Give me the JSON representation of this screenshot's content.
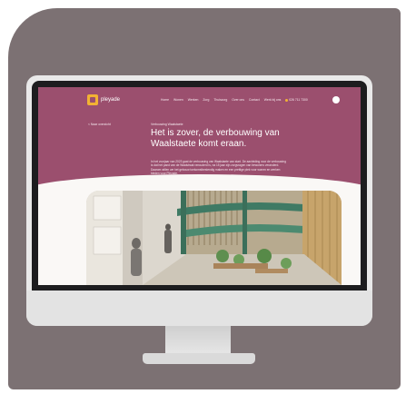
{
  "site": {
    "logo_text": "pleyade",
    "nav_items": [
      "Home",
      "Wonen",
      "Werken",
      "Zorg",
      "Thuiszorg",
      "Over ons",
      "Contact",
      "Werk bij ons"
    ],
    "phone": "026 711 7300",
    "back_label": "< Naar overzicht",
    "breadcrumb": "Verbouwing Waalstaete",
    "headline": "Het is zover, de verbouwing van Waalstaete komt eraan.",
    "intro": "In het voorjaar van 2023 gaat de verbouwing van Waalstaete van start. De aanleiding voor de verbouwing is dat het pand van de Waalstraat verouderd is, na 15 jaar zijn zorgvragen van bewoners veranderd. Daarom willen we het gebouw toekomstbestendig maken en een prettige plek voor wonen en werken bieden voor Pleyade."
  },
  "colors": {
    "card_background": "#7c7173",
    "hero_background": "#9b4f6e",
    "accent": "#f2b233",
    "monitor_bezel": "#1d1d1f",
    "monitor_body": "#e9e9e9"
  },
  "icons": {
    "logo": "pleyade-logo-icon",
    "phone": "phone-icon",
    "search": "search-icon"
  }
}
